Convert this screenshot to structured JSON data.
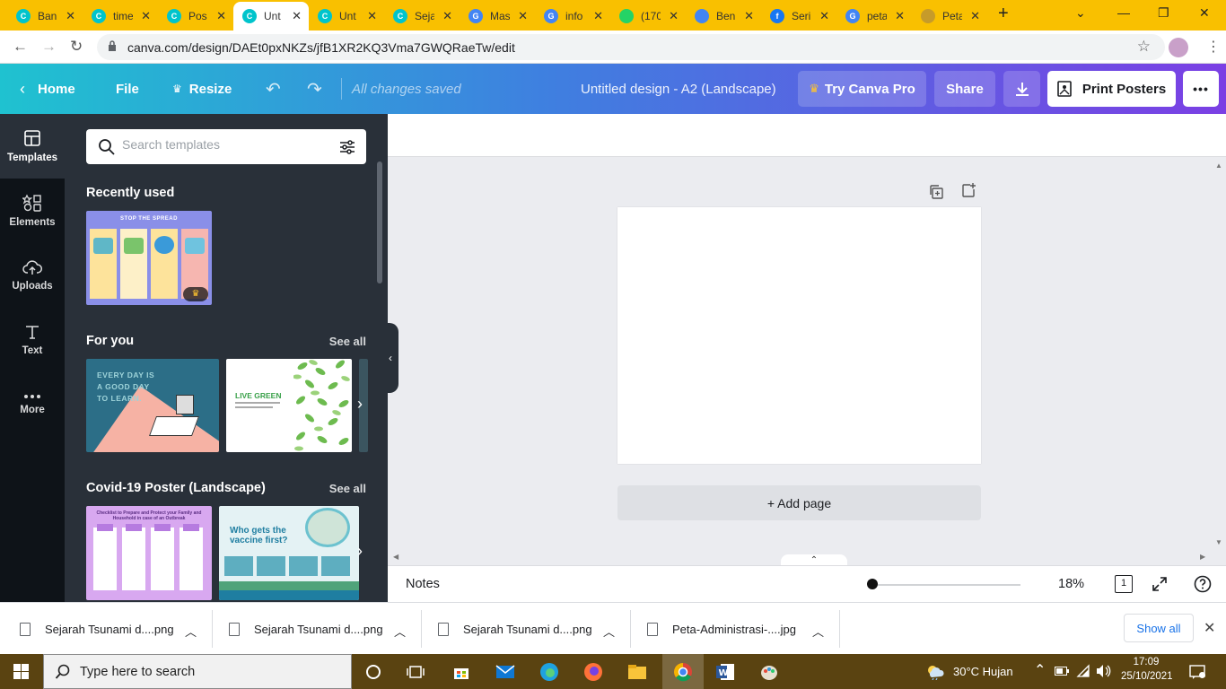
{
  "browser": {
    "tabs": [
      {
        "title": "Ban",
        "icon": "canva-icon",
        "color": "#00c4cc"
      },
      {
        "title": "time",
        "icon": "canva-icon",
        "color": "#00c4cc"
      },
      {
        "title": "Pos",
        "icon": "canva-icon",
        "color": "#00c4cc"
      },
      {
        "title": "Unt",
        "icon": "canva-icon",
        "color": "#00c4cc",
        "active": true
      },
      {
        "title": "Unt",
        "icon": "canva-icon",
        "color": "#00c4cc"
      },
      {
        "title": "Seja",
        "icon": "canva-icon",
        "color": "#00c4cc"
      },
      {
        "title": "Mas",
        "icon": "google-icon",
        "color": "#4285f4"
      },
      {
        "title": "info",
        "icon": "google-icon",
        "color": "#4285f4"
      },
      {
        "title": "(170",
        "icon": "whatsapp-icon",
        "color": "#25d366"
      },
      {
        "title": "Ben",
        "icon": "docs-icon",
        "color": "#4285f4"
      },
      {
        "title": "Seri",
        "icon": "facebook-icon",
        "color": "#1877f2"
      },
      {
        "title": "peta",
        "icon": "google-icon",
        "color": "#4285f4"
      },
      {
        "title": "Peta",
        "icon": "map-icon",
        "color": "#c69b2a"
      }
    ],
    "url": "canva.com/design/DAEt0pxNKZs/jfB1XR2KQ3Vma7GWQRaeTw/edit",
    "new_tab": "+",
    "close_symbol": "✕"
  },
  "header": {
    "home": "Home",
    "file": "File",
    "resize": "Resize",
    "saved_status": "All changes saved",
    "design_title": "Untitled design - A2 (Landscape)",
    "try_pro": "Try Canva Pro",
    "share": "Share",
    "print": "Print Posters",
    "more": "•••"
  },
  "rail": {
    "items": [
      {
        "label": "Templates",
        "icon": "templates-icon"
      },
      {
        "label": "Elements",
        "icon": "elements-icon"
      },
      {
        "label": "Uploads",
        "icon": "uploads-icon"
      },
      {
        "label": "Text",
        "icon": "text-icon"
      },
      {
        "label": "More",
        "icon": "more-icon"
      }
    ]
  },
  "panel": {
    "search_placeholder": "Search templates",
    "recently_used": "Recently used",
    "for_you": "For you",
    "see_all": "See all",
    "covid_title": "Covid-19 Poster (Landscape)",
    "thumbs": {
      "spread_title": "STOP THE SPREAD",
      "everyday_text": "EVERY DAY IS A GOOD DAY TO LEARN.",
      "livegreen_text": "LIVE GREEN",
      "checklist_text": "Checklist to Prepare and Protect your Family and Household in case of an Outbreak",
      "vaccine_text": "Who gets the vaccine first?"
    }
  },
  "canvas": {
    "add_page": "+ Add page"
  },
  "footer": {
    "notes": "Notes",
    "zoom": "18%",
    "zoom_fraction": 0.18,
    "page_count": "1"
  },
  "downloads": {
    "items": [
      "Sejarah Tsunami d....png",
      "Sejarah Tsunami d....png",
      "Sejarah Tsunami d....png",
      "Peta-Administrasi-....jpg"
    ],
    "show_all": "Show all"
  },
  "taskbar": {
    "search_placeholder": "Type here to search",
    "weather": "30°C  Hujan",
    "time": "17:09",
    "date": "25/10/2021"
  }
}
